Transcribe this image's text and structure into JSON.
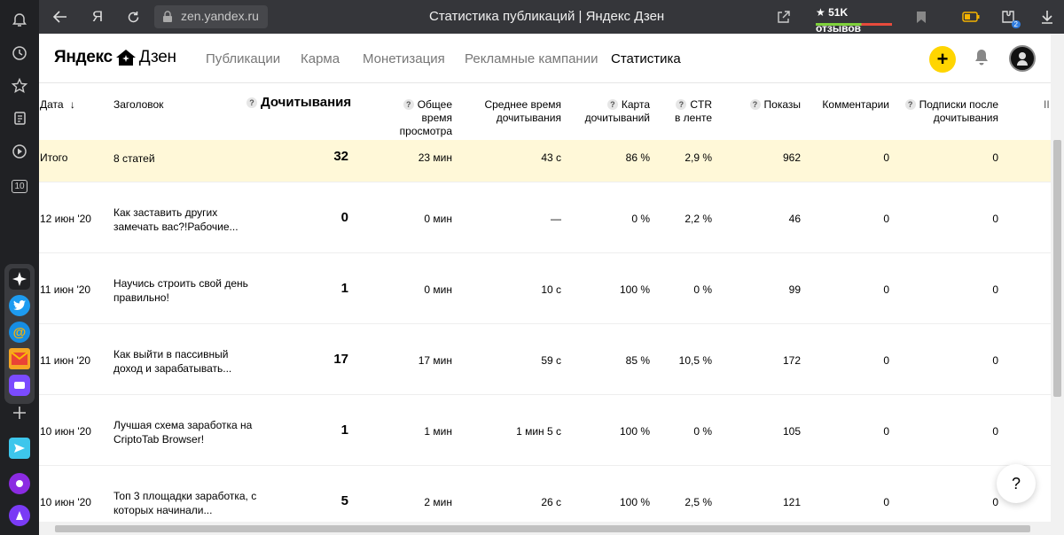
{
  "browser": {
    "url": "zen.yandex.ru",
    "page_title": "Статистика публикаций | Яндекс Дзен",
    "reviews_label": "★ 51K отзывов",
    "badge_count": "2",
    "tab_count": "10"
  },
  "site": {
    "logo_left": "Яндекс",
    "logo_right": "Дзен",
    "nav": [
      "Публикации",
      "Карма",
      "Монетизация",
      "Рекламные кампании",
      "Статистика"
    ],
    "plus_label": "+",
    "help_label": "?"
  },
  "table": {
    "headers": {
      "date": "Дата",
      "title": "Заголовок",
      "reads": "Дочитывания",
      "total_time": "Общее время просмотра",
      "avg_time": "Среднее время дочитывания",
      "map": "Карта дочитываний",
      "ctr": "CTR в ленте",
      "shows": "Показы",
      "comments": "Комментарии",
      "subs": "Подписки после дочитывания",
      "more": "II"
    },
    "header_lines": {
      "total_time": [
        "Общее время",
        "просмотра"
      ],
      "avg_time": [
        "Среднее время",
        "дочитывания"
      ],
      "map": [
        "Карта",
        "дочитываний"
      ],
      "ctr": [
        "CTR",
        "в ленте"
      ],
      "subs": [
        "Подписки после",
        "дочитывания"
      ]
    },
    "total": {
      "date": "Итого",
      "title": "8 статей",
      "reads": "32",
      "total_time": "23 мин",
      "avg_time": "43 с",
      "map": "86 %",
      "ctr": "2,9 %",
      "shows": "962",
      "comments": "0",
      "subs": "0"
    },
    "rows": [
      {
        "date": "12 июн '20",
        "title": "Как заставить других замечать вас?!Рабочие...",
        "reads": "0",
        "total_time": "0 мин",
        "avg_time": "—",
        "map": "0 %",
        "ctr": "2,2 %",
        "shows": "46",
        "comments": "0",
        "subs": "0"
      },
      {
        "date": "11 июн '20",
        "title": "Научись строить свой день правильно!",
        "reads": "1",
        "total_time": "0 мин",
        "avg_time": "10 с",
        "map": "100 %",
        "ctr": "0 %",
        "shows": "99",
        "comments": "0",
        "subs": "0"
      },
      {
        "date": "11 июн '20",
        "title": "Как выйти в пассивный доход и зарабатывать...",
        "reads": "17",
        "total_time": "17 мин",
        "avg_time": "59 с",
        "map": "85 %",
        "ctr": "10,5 %",
        "shows": "172",
        "comments": "0",
        "subs": "0"
      },
      {
        "date": "10 июн '20",
        "title": "Лучшая схема заработка на CriptoTab Browser!",
        "reads": "1",
        "total_time": "1 мин",
        "avg_time": "1 мин 5 с",
        "map": "100 %",
        "ctr": "0 %",
        "shows": "105",
        "comments": "0",
        "subs": "0"
      },
      {
        "date": "10 июн '20",
        "title": "Топ 3 площадки заработка, с которых начинали...",
        "reads": "5",
        "total_time": "2 мин",
        "avg_time": "26 с",
        "map": "100 %",
        "ctr": "2,5 %",
        "shows": "121",
        "comments": "0",
        "subs": "0"
      }
    ]
  }
}
